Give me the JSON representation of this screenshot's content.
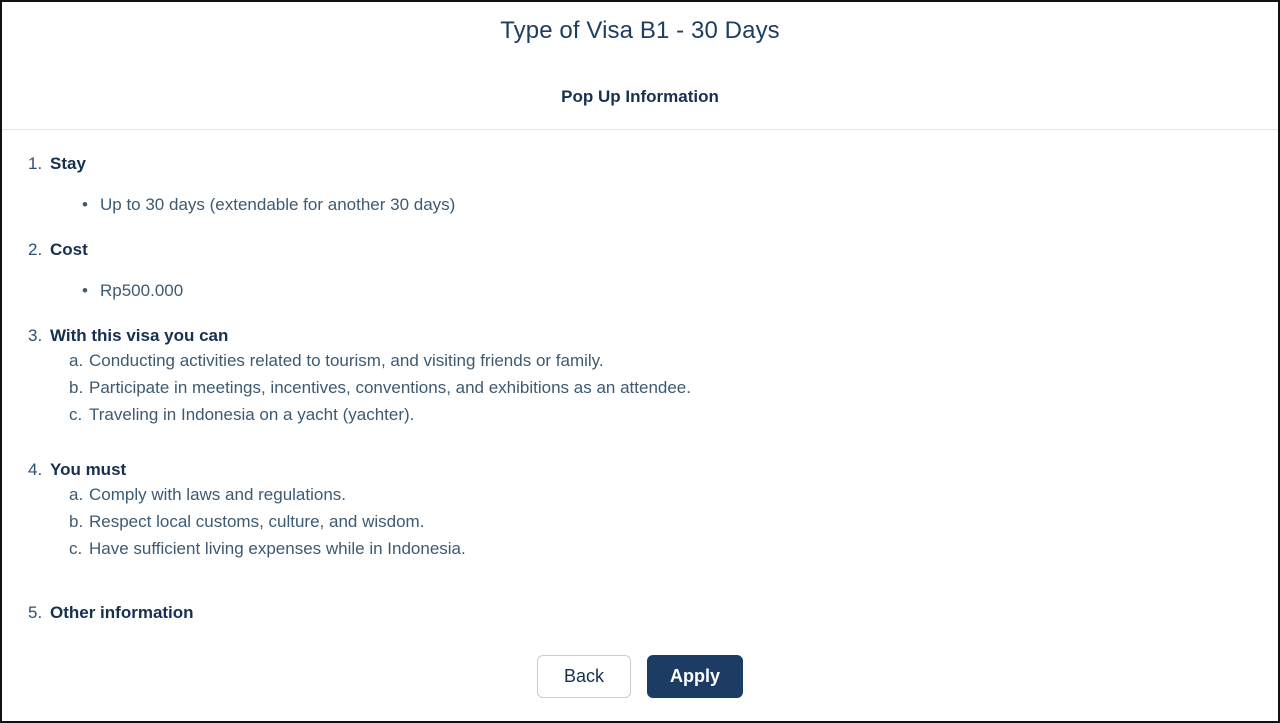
{
  "header": {
    "title": "Type of Visa B1 - 30 Days",
    "subtitle": "Pop Up Information"
  },
  "sections": [
    {
      "number": "1.",
      "heading": "Stay",
      "bullets": [
        "Up to 30 days (extendable for another 30 days)"
      ],
      "sub_items": []
    },
    {
      "number": "2.",
      "heading": "Cost",
      "bullets": [
        "Rp500.000"
      ],
      "sub_items": []
    },
    {
      "number": "3.",
      "heading": "With this visa you can",
      "bullets": [],
      "sub_items": [
        {
          "label": "a.",
          "text": "Conducting activities related to tourism, and visiting friends or family."
        },
        {
          "label": "b.",
          "text": "Participate in meetings, incentives, conventions, and exhibitions as an attendee."
        },
        {
          "label": "c.",
          "text": "Traveling in Indonesia on a yacht (yachter)."
        }
      ]
    },
    {
      "number": "4.",
      "heading": "You must",
      "bullets": [],
      "sub_items": [
        {
          "label": "a.",
          "text": "Comply with laws and regulations."
        },
        {
          "label": "b.",
          "text": "Respect local customs, culture, and wisdom."
        },
        {
          "label": "c.",
          "text": "Have sufficient living expenses while in Indonesia."
        }
      ]
    },
    {
      "number": "5.",
      "heading": "Other information",
      "bullets": [],
      "sub_items": []
    }
  ],
  "footer": {
    "back_label": "Back",
    "apply_label": "Apply"
  },
  "bullet_glyph": "•",
  "colors": {
    "title": "#1f3d63",
    "heading": "#16304f",
    "body": "#3d5a73",
    "apply_bg": "#1c3c63",
    "divider": "#e2e5e8",
    "back_border": "#c9ced4"
  }
}
